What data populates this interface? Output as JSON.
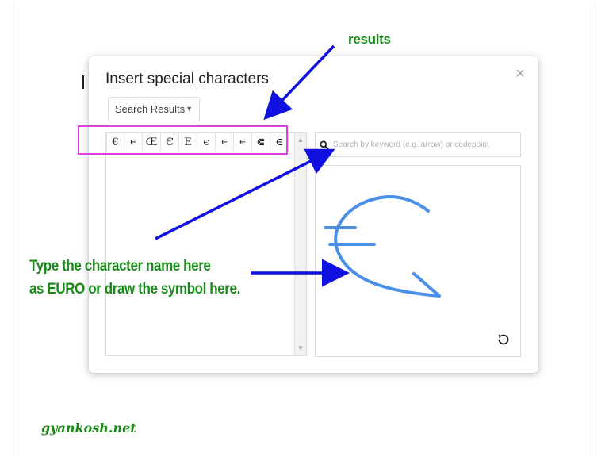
{
  "dialog": {
    "title": "Insert special characters",
    "close_symbol": "×",
    "category": "Search Results",
    "search_placeholder": "Search by keyword (e.g. arrow) or codepoint",
    "results": [
      {
        "char": "€"
      },
      {
        "char": "∊"
      },
      {
        "char": "Œ"
      },
      {
        "char": "Є"
      },
      {
        "char": "Е"
      },
      {
        "char": "є"
      },
      {
        "char": "∊"
      },
      {
        "char": "∊"
      },
      {
        "char": "⋐"
      },
      {
        "char": "∈"
      }
    ],
    "icons": {
      "search": "search-icon",
      "reset": "reset-icon",
      "close": "close-icon"
    }
  },
  "annotations": {
    "results_label": "results",
    "instruction_line1": "Type the character name here",
    "instruction_line2": "as EURO or draw the symbol here.",
    "watermark": "gyankosh.net",
    "arrow_color": "#1010e0",
    "text_color": "#1a8a1a",
    "highlight_color": "#e040e0",
    "sketch_color": "#4a90e8"
  }
}
